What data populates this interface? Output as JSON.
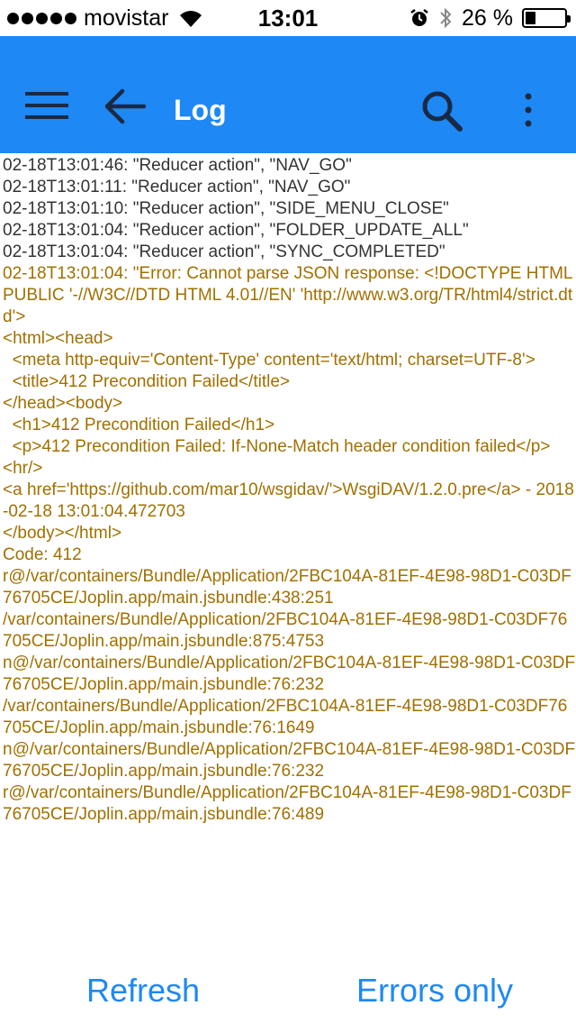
{
  "status_bar": {
    "carrier": "movistar",
    "time": "13:01",
    "battery_percent_text": "26 %",
    "battery_level": 0.26
  },
  "app_bar": {
    "title": "Log",
    "background_color": "#1e88f5",
    "icons": [
      "menu-icon",
      "back-arrow-icon",
      "search-icon",
      "more-vertical-icon"
    ]
  },
  "log": {
    "entries": [
      {
        "level": "info",
        "text": "02-18T13:01:46: \"Reducer action\", \"NAV_GO\""
      },
      {
        "level": "info",
        "text": "02-18T13:01:11: \"Reducer action\", \"NAV_GO\""
      },
      {
        "level": "info",
        "text": "02-18T13:01:10: \"Reducer action\", \"SIDE_MENU_CLOSE\""
      },
      {
        "level": "info",
        "text": "02-18T13:01:04: \"Reducer action\", \"FOLDER_UPDATE_ALL\""
      },
      {
        "level": "info",
        "text": "02-18T13:01:04: \"Reducer action\", \"SYNC_COMPLETED\""
      },
      {
        "level": "error",
        "text": "02-18T13:01:04: \"Error: Cannot parse JSON response: <!DOCTYPE HTML PUBLIC '-//W3C//DTD HTML 4.01//EN' 'http://www.w3.org/TR/html4/strict.dtd'>\n<html><head>\n  <meta http-equiv='Content-Type' content='text/html; charset=UTF-8'>\n  <title>412 Precondition Failed</title>\n</head><body>\n  <h1>412 Precondition Failed</h1>\n  <p>412 Precondition Failed: If-None-Match header condition failed</p>\n<hr/>\n<a href='https://github.com/mar10/wsgidav/'>WsgiDAV/1.2.0.pre</a> - 2018-02-18 13:01:04.472703\n</body></html>\nCode: 412\nr@/var/containers/Bundle/Application/2FBC104A-81EF-4E98-98D1-C03DF76705CE/Joplin.app/main.jsbundle:438:251\n/var/containers/Bundle/Application/2FBC104A-81EF-4E98-98D1-C03DF76705CE/Joplin.app/main.jsbundle:875:4753\nn@/var/containers/Bundle/Application/2FBC104A-81EF-4E98-98D1-C03DF76705CE/Joplin.app/main.jsbundle:76:232\n/var/containers/Bundle/Application/2FBC104A-81EF-4E98-98D1-C03DF76705CE/Joplin.app/main.jsbundle:76:1649\nn@/var/containers/Bundle/Application/2FBC104A-81EF-4E98-98D1-C03DF76705CE/Joplin.app/main.jsbundle:76:232\nr@/var/containers/Bundle/Application/2FBC104A-81EF-4E98-98D1-C03DF76705CE/Joplin.app/main.jsbundle:76:489"
      }
    ],
    "info_color": "#333333",
    "error_color": "#a07000"
  },
  "bottom_bar": {
    "refresh_label": "Refresh",
    "errors_only_label": "Errors only",
    "button_color": "#1e88f5"
  }
}
